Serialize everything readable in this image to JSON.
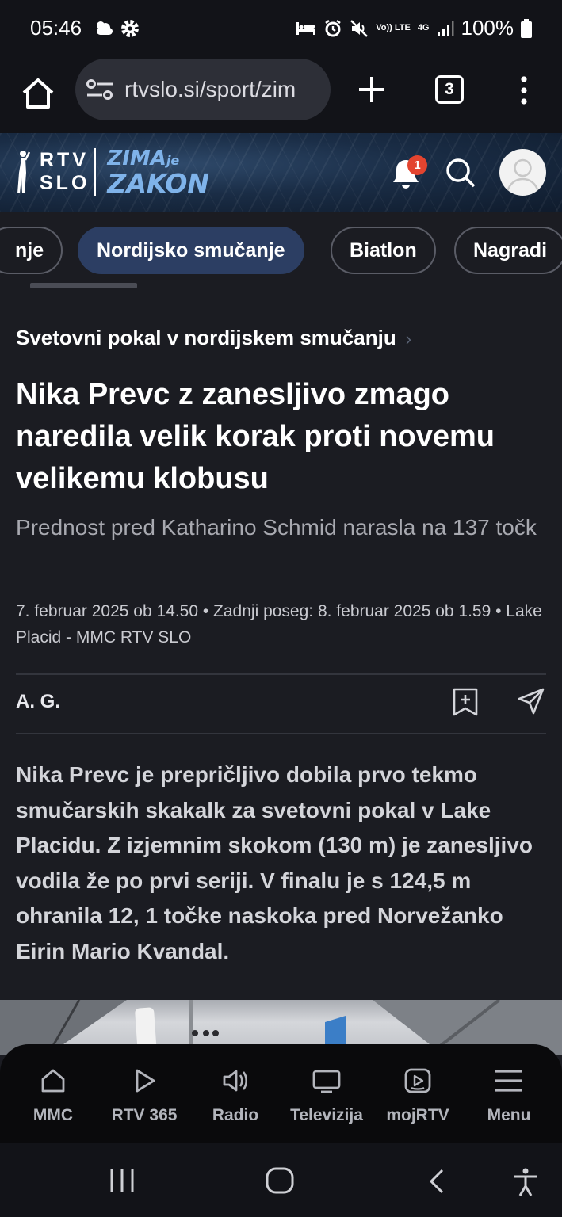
{
  "status_bar": {
    "time": "05:46",
    "battery": "100%",
    "network": "4G",
    "volte": "Vo)) LTE",
    "icons": [
      "cloud-sun-icon",
      "gear-icon",
      "bed-icon",
      "alarm-icon",
      "mute-icon",
      "signal-icon",
      "battery-icon"
    ]
  },
  "browser": {
    "url": "rtvslo.si/sport/zim",
    "tab_count": "3"
  },
  "site_header": {
    "logo_line1": "RTV",
    "logo_line2": "SLO",
    "sublogo_top": "ZIMA",
    "sublogo_je": "je",
    "sublogo_bottom": "ZAKON",
    "notification_count": "1"
  },
  "categories": [
    {
      "label": "nje",
      "active": false
    },
    {
      "label": "Nordijsko smučanje",
      "active": true
    },
    {
      "label": "Biatlon",
      "active": false
    },
    {
      "label": "Nagradi",
      "active": false
    }
  ],
  "article": {
    "kicker": "Svetovni pokal v nordijskem smučanju",
    "headline": "Nika Prevc z zanesljivo zmago naredila velik korak proti novemu velikemu klobusu",
    "subtitle": "Prednost pred Katharino Schmid narasla na 137 točk",
    "meta": "7. februar 2025 ob 14.50 • Zadnji poseg: 8. februar 2025 ob 1.59 • Lake Placid - MMC RTV SLO",
    "author": "A. G.",
    "lead": "Nika Prevc je prepričljivo dobila prvo tekmo smučarskih skakalk za svetovni pokal v Lake Placidu. Z izjemnim skokom (130 m) je zanesljivo vodila že po prvi seriji. V finalu je s 124,5 m ohranila 12, 1 točke naskoka pred Norvežanko Eirin Mario Kvandal."
  },
  "bottom_nav": [
    {
      "label": "MMC",
      "icon": "home-icon"
    },
    {
      "label": "RTV 365",
      "icon": "play-icon"
    },
    {
      "label": "Radio",
      "icon": "speaker-icon"
    },
    {
      "label": "Televizija",
      "icon": "tv-icon"
    },
    {
      "label": "mojRTV",
      "icon": "my-rtv-icon"
    },
    {
      "label": "Menu",
      "icon": "hamburger-icon"
    }
  ],
  "colors": {
    "background": "#1b1c22",
    "active_pill": "#2c3e63",
    "badge": "#e3442f",
    "logo_accent": "#7fb3ea"
  }
}
